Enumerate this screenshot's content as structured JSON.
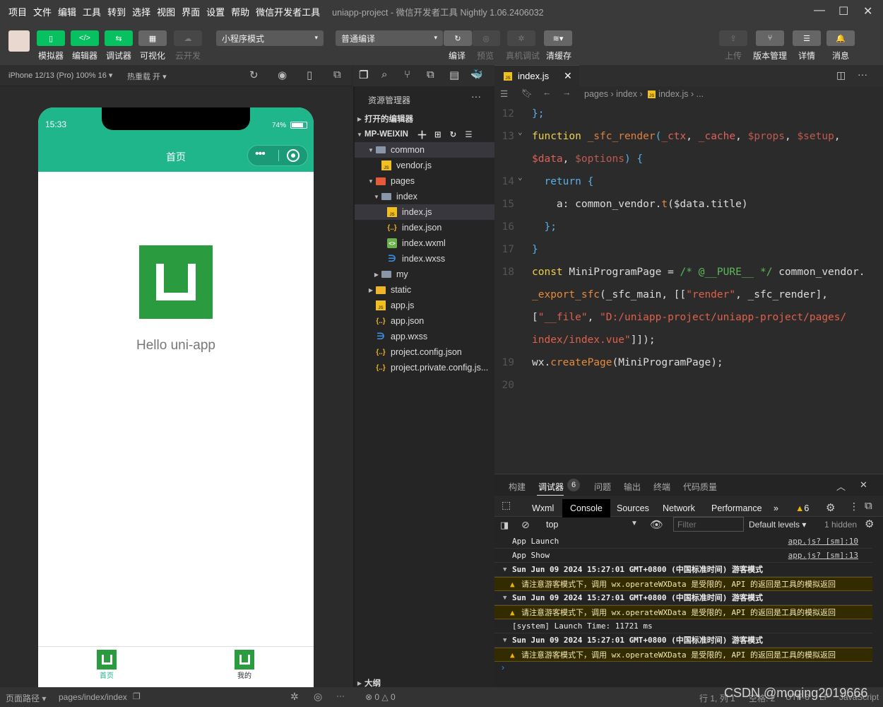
{
  "menu": [
    "项目",
    "文件",
    "编辑",
    "工具",
    "转到",
    "选择",
    "视图",
    "界面",
    "设置",
    "帮助",
    "微信开发者工具"
  ],
  "window_title": "uniapp-project - 微信开发者工具 Nightly 1.06.2406032",
  "toolbar": {
    "simulator": "模拟器",
    "editor": "编辑器",
    "debugger": "调试器",
    "visual": "可视化",
    "cloud": "云开发",
    "mode": "小程序模式",
    "compile_mode": "普通编译",
    "compile": "编译",
    "preview": "预览",
    "remote_debug": "真机调试",
    "clear_cache": "清缓存",
    "upload": "上传",
    "version": "版本管理",
    "details": "详情",
    "messages": "消息"
  },
  "simbar": {
    "device": "iPhone 12/13 (Pro) 100% 16 ▾",
    "hot_reload": "热重载 开 ▾"
  },
  "phone": {
    "time": "15:33",
    "battery": "74%",
    "nav_title": "首页",
    "hello": "Hello uni-app",
    "tabs": [
      "首页",
      "我的"
    ]
  },
  "explorer": {
    "title": "资源管理器",
    "open_editors": "打开的编辑器",
    "root": "MP-WEIXIN",
    "outline": "大纲",
    "items": [
      {
        "label": "common",
        "icon": "folder",
        "arrow": "▼",
        "level": 1,
        "active": true
      },
      {
        "label": "vendor.js",
        "icon": "js",
        "level": 2
      },
      {
        "label": "pages",
        "icon": "fpages",
        "arrow": "▼",
        "level": 1
      },
      {
        "label": "index",
        "icon": "folder",
        "arrow": "▼",
        "level": 2
      },
      {
        "label": "index.js",
        "icon": "js",
        "level": 3,
        "active": true
      },
      {
        "label": "index.json",
        "icon": "json",
        "level": 3
      },
      {
        "label": "index.wxml",
        "icon": "wxml",
        "level": 3
      },
      {
        "label": "index.wxss",
        "icon": "wxss",
        "level": 3
      },
      {
        "label": "my",
        "icon": "folder",
        "arrow": "▶",
        "level": 2
      },
      {
        "label": "static",
        "icon": "fstatic",
        "arrow": "▶",
        "level": 1
      },
      {
        "label": "app.js",
        "icon": "js",
        "level": 1
      },
      {
        "label": "app.json",
        "icon": "json",
        "level": 1
      },
      {
        "label": "app.wxss",
        "icon": "wxss",
        "level": 1
      },
      {
        "label": "project.config.json",
        "icon": "json",
        "level": 1
      },
      {
        "label": "project.private.config.js...",
        "icon": "json",
        "level": 1
      }
    ]
  },
  "editor": {
    "tab": "index.js",
    "breadcrumb": [
      "pages",
      "index",
      "index.js",
      "..."
    ],
    "rows": [
      {
        "ln": "12",
        "t": [
          [
            "b",
            "};"
          ]
        ]
      },
      {
        "ln": "13",
        "fold": true,
        "t": [
          [
            "k",
            "function "
          ],
          [
            "f",
            "_sfc_render"
          ],
          [
            "b",
            "("
          ],
          [
            "p",
            "_ctx"
          ],
          [
            "n",
            ", "
          ],
          [
            "p",
            "_cache"
          ],
          [
            "n",
            ", "
          ],
          [
            "pm",
            "$props"
          ],
          [
            "n",
            ", "
          ],
          [
            "pm",
            "$setup"
          ],
          [
            "n",
            ","
          ]
        ]
      },
      {
        "ln": "",
        "t": [
          [
            "p",
            "$data"
          ],
          [
            "n",
            ", "
          ],
          [
            "pm",
            "$options"
          ],
          [
            "b",
            ") {"
          ]
        ]
      },
      {
        "ln": "14",
        "fold": true,
        "t": [
          [
            "n",
            "  "
          ],
          [
            "b",
            "return {"
          ]
        ]
      },
      {
        "ln": "15",
        "t": [
          [
            "n",
            "    a: common_vendor."
          ],
          [
            "m",
            "t"
          ],
          [
            "n",
            "($data.title)"
          ]
        ]
      },
      {
        "ln": "16",
        "t": [
          [
            "n",
            "  "
          ],
          [
            "b",
            "};"
          ]
        ]
      },
      {
        "ln": "17",
        "t": [
          [
            "b",
            "}"
          ]
        ]
      },
      {
        "ln": "18",
        "t": [
          [
            "k",
            "const "
          ],
          [
            "n",
            "MiniProgramPage = "
          ],
          [
            "c",
            "/* @__PURE__ */ "
          ],
          [
            "n",
            "common_vendor."
          ]
        ]
      },
      {
        "ln": "",
        "t": [
          [
            "m",
            "_export_sfc"
          ],
          [
            "n",
            "(_sfc_main, [["
          ],
          [
            "s",
            "\"render\""
          ],
          [
            "n",
            ", _sfc_render],"
          ]
        ]
      },
      {
        "ln": "",
        "t": [
          [
            "n",
            "["
          ],
          [
            "s",
            "\"__file\""
          ],
          [
            "n",
            ", "
          ],
          [
            "s",
            "\"D:/uniapp-project/uniapp-project/pages/"
          ]
        ]
      },
      {
        "ln": "",
        "t": [
          [
            "s",
            "index/index.vue\""
          ],
          [
            "n",
            "]]);"
          ]
        ]
      },
      {
        "ln": "19",
        "t": [
          [
            "n",
            "wx."
          ],
          [
            "m",
            "createPage"
          ],
          [
            "n",
            "(MiniProgramPage);"
          ]
        ]
      },
      {
        "ln": "20",
        "t": []
      }
    ]
  },
  "debug": {
    "tabs": [
      "构建",
      "调试器",
      "问题",
      "输出",
      "终端",
      "代码质量"
    ],
    "badge": "6",
    "devtools_tabs": [
      "Wxml",
      "Console",
      "Sources",
      "Network",
      "Performance"
    ],
    "warn_count": "6",
    "context": "top",
    "filter_placeholder": "Filter",
    "levels": "Default levels ▾",
    "hidden": "1 hidden",
    "logs": [
      {
        "type": "log",
        "text": "App Launch",
        "src": "app.js? [sm]:10"
      },
      {
        "type": "log",
        "text": "App Show",
        "src": "app.js? [sm]:13"
      },
      {
        "type": "grp",
        "text": "Sun Jun 09 2024 15:27:01 GMT+0800 (中国标准时间) 游客模式"
      },
      {
        "type": "warn",
        "text": "请注意游客模式下，调用 wx.operateWXData 是受限的, API 的返回是工具的模拟返回"
      },
      {
        "type": "grp",
        "text": "Sun Jun 09 2024 15:27:01 GMT+0800 (中国标准时间) 游客模式"
      },
      {
        "type": "warn",
        "text": "请注意游客模式下，调用 wx.operateWXData 是受限的, API 的返回是工具的模拟返回"
      },
      {
        "type": "log",
        "text": "[system] Launch Time: 11721 ms"
      },
      {
        "type": "grp",
        "text": "Sun Jun 09 2024 15:27:01 GMT+0800 (中国标准时间) 游客模式"
      },
      {
        "type": "warn",
        "text": "请注意游客模式下，调用 wx.operateWXData 是受限的, API 的返回是工具的模拟返回"
      }
    ]
  },
  "status": {
    "page_path_label": "页面路径 ▾",
    "page_path": "pages/index/index",
    "errors": "0",
    "warnings": "0",
    "cursor": "行 1, 列 1",
    "spaces": "空格: 2",
    "encoding": "UTF-8",
    "eol": "LF",
    "language": "JavaScript",
    "watermark": "CSDN @moqing2019666"
  }
}
